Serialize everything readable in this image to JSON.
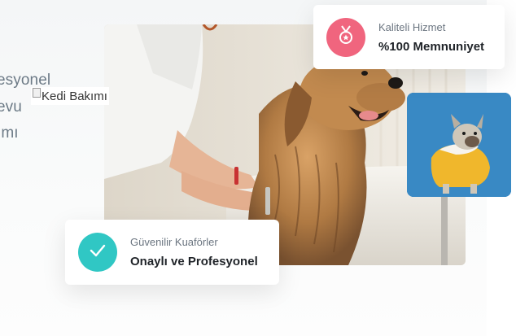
{
  "intro": {
    "line1": "esyonel",
    "line2": "evu",
    "line3": "ımı"
  },
  "broken_image": {
    "alt": "Kedi Bakımı"
  },
  "quality_card": {
    "subtitle": "Kaliteli Hizmet",
    "title": "%100 Memnuniyet",
    "icon": "medal-icon",
    "color": "#f0657e"
  },
  "trust_card": {
    "subtitle": "Güvenilir Kuaförler",
    "title": "Onaylı ve Profesyonel",
    "icon": "check-icon",
    "color": "#30c7c4"
  }
}
